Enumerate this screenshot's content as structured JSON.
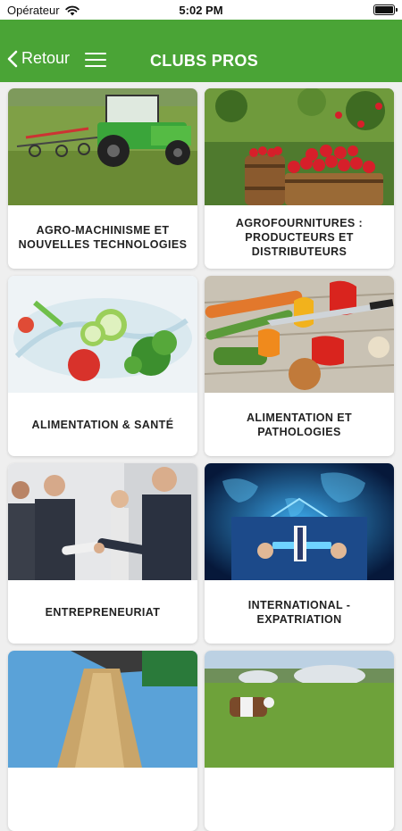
{
  "status": {
    "carrier": "Opérateur",
    "time": "5:02 PM"
  },
  "nav": {
    "back_label": "Retour",
    "title": "CLUBS PROS"
  },
  "cards": [
    {
      "label": "AGRO-MACHINISME ET NOUVELLES TECHNOLOGIES",
      "image": "tractor-photo"
    },
    {
      "label": "AGROFOURNITURES : PRODUCTEURS ET DISTRIBUTEURS",
      "image": "apples-barrel-photo"
    },
    {
      "label": "ALIMENTATION & SANTÉ",
      "image": "vegetables-splash-photo"
    },
    {
      "label": "ALIMENTATION ET PATHOLOGIES",
      "image": "vegetables-knife-photo"
    },
    {
      "label": "ENTREPRENEURIAT",
      "image": "handshake-photo"
    },
    {
      "label": "INTERNATIONAL - EXPATRIATION",
      "image": "world-tablet-photo"
    },
    {
      "label": "",
      "image": "grain-harvest-photo"
    },
    {
      "label": "",
      "image": "cow-biogas-photo"
    }
  ],
  "colors": {
    "header": "#4aa436",
    "background": "#efefef"
  }
}
